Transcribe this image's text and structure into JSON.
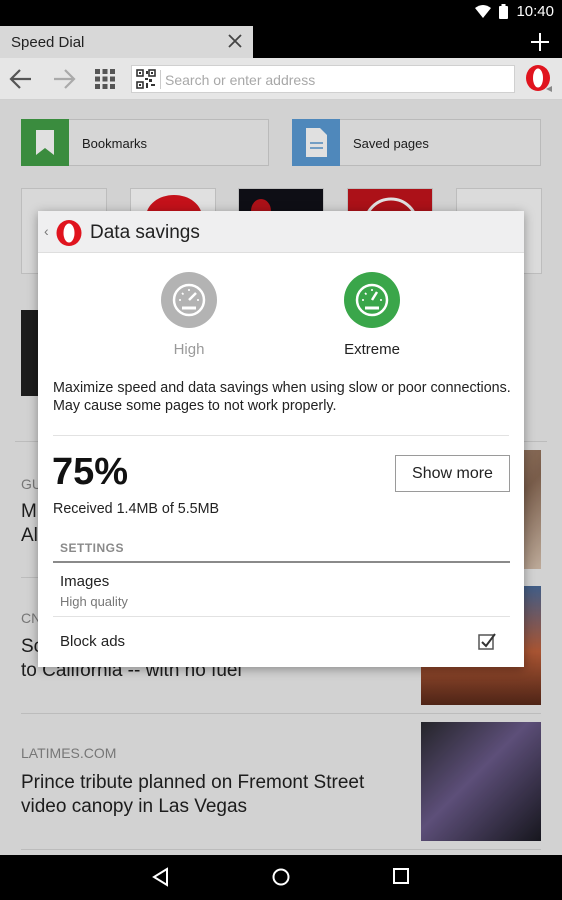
{
  "status_bar": {
    "time": "10:40",
    "icons": [
      "wifi-icon",
      "battery-icon"
    ]
  },
  "tab": {
    "title": "Speed Dial",
    "close_icon": "close-icon",
    "new_tab_icon": "plus-icon"
  },
  "toolbar": {
    "back_icon": "arrow-left-icon",
    "forward_icon": "arrow-right-icon",
    "tabs_grid_icon": "grid-icon",
    "qr_icon": "qr-code-icon",
    "address_placeholder": "Search or enter address",
    "menu_icon": "opera-logo-icon"
  },
  "speed_dial": {
    "bookmarks_label": "Bookmarks",
    "saved_pages_label": "Saved pages"
  },
  "news": [
    {
      "source": "GU",
      "title": "M\nAl"
    },
    {
      "source": "CN",
      "title": "Sc\nto California -- with no fuel"
    },
    {
      "source": "LATIMES.COM",
      "title": "Prince tribute planned on Fremont Street video canopy in Las Vegas"
    }
  ],
  "dialog": {
    "title": "Data savings",
    "back_glyph": "‹",
    "modes": [
      {
        "label": "High",
        "selected": false,
        "color": "#b3b3b3"
      },
      {
        "label": "Extreme",
        "selected": true,
        "color": "#3aa64a"
      }
    ],
    "description": "Maximize speed and data savings when using slow or poor connections. May cause some pages to not work properly.",
    "savings_percent": "75%",
    "received_text": "Received 1.4MB of 5.5MB",
    "show_more_label": "Show more",
    "settings_header": "SETTINGS",
    "settings": [
      {
        "title": "Images",
        "subtitle": "High quality"
      },
      {
        "title": "Block ads",
        "checked": true
      }
    ]
  },
  "nav_bar": {
    "icons": [
      "back-triangle-icon",
      "home-circle-icon",
      "recents-square-icon"
    ]
  },
  "colors": {
    "opera_red": "#e0141e",
    "accent_green": "#3aa64a",
    "bookmarks_green": "#43a047",
    "saved_blue": "#5b9bd5"
  }
}
